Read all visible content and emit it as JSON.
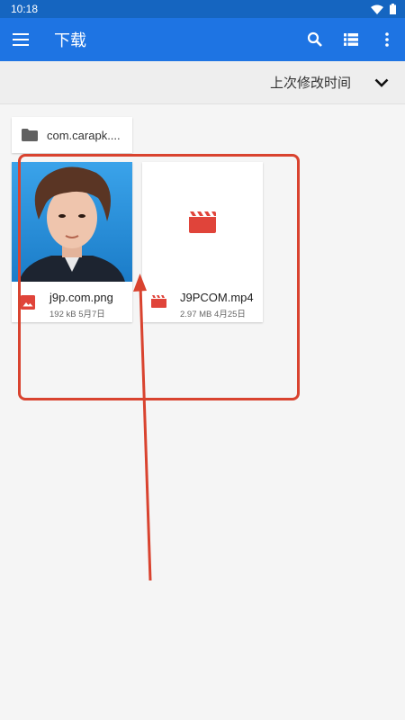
{
  "status_bar": {
    "time": "10:18"
  },
  "app_bar": {
    "title": "下载",
    "icons": [
      "menu-icon",
      "search-icon",
      "view-list-icon",
      "more-vert-icon"
    ]
  },
  "sort": {
    "label": "上次修改时间"
  },
  "folders": [
    {
      "name": "com.carapk...."
    }
  ],
  "files": [
    {
      "name": "j9p.com.png",
      "size": "192 kB",
      "date": "5月7日",
      "type": "image"
    },
    {
      "name": "J9PCOM.mp4",
      "size": "2.97 MB",
      "date": "4月25日",
      "type": "video"
    }
  ],
  "colors": {
    "status_bar": "#1565c0",
    "app_bar": "#1e74e3",
    "file_icon": "#e0443a",
    "annotation": "#d9432f"
  }
}
